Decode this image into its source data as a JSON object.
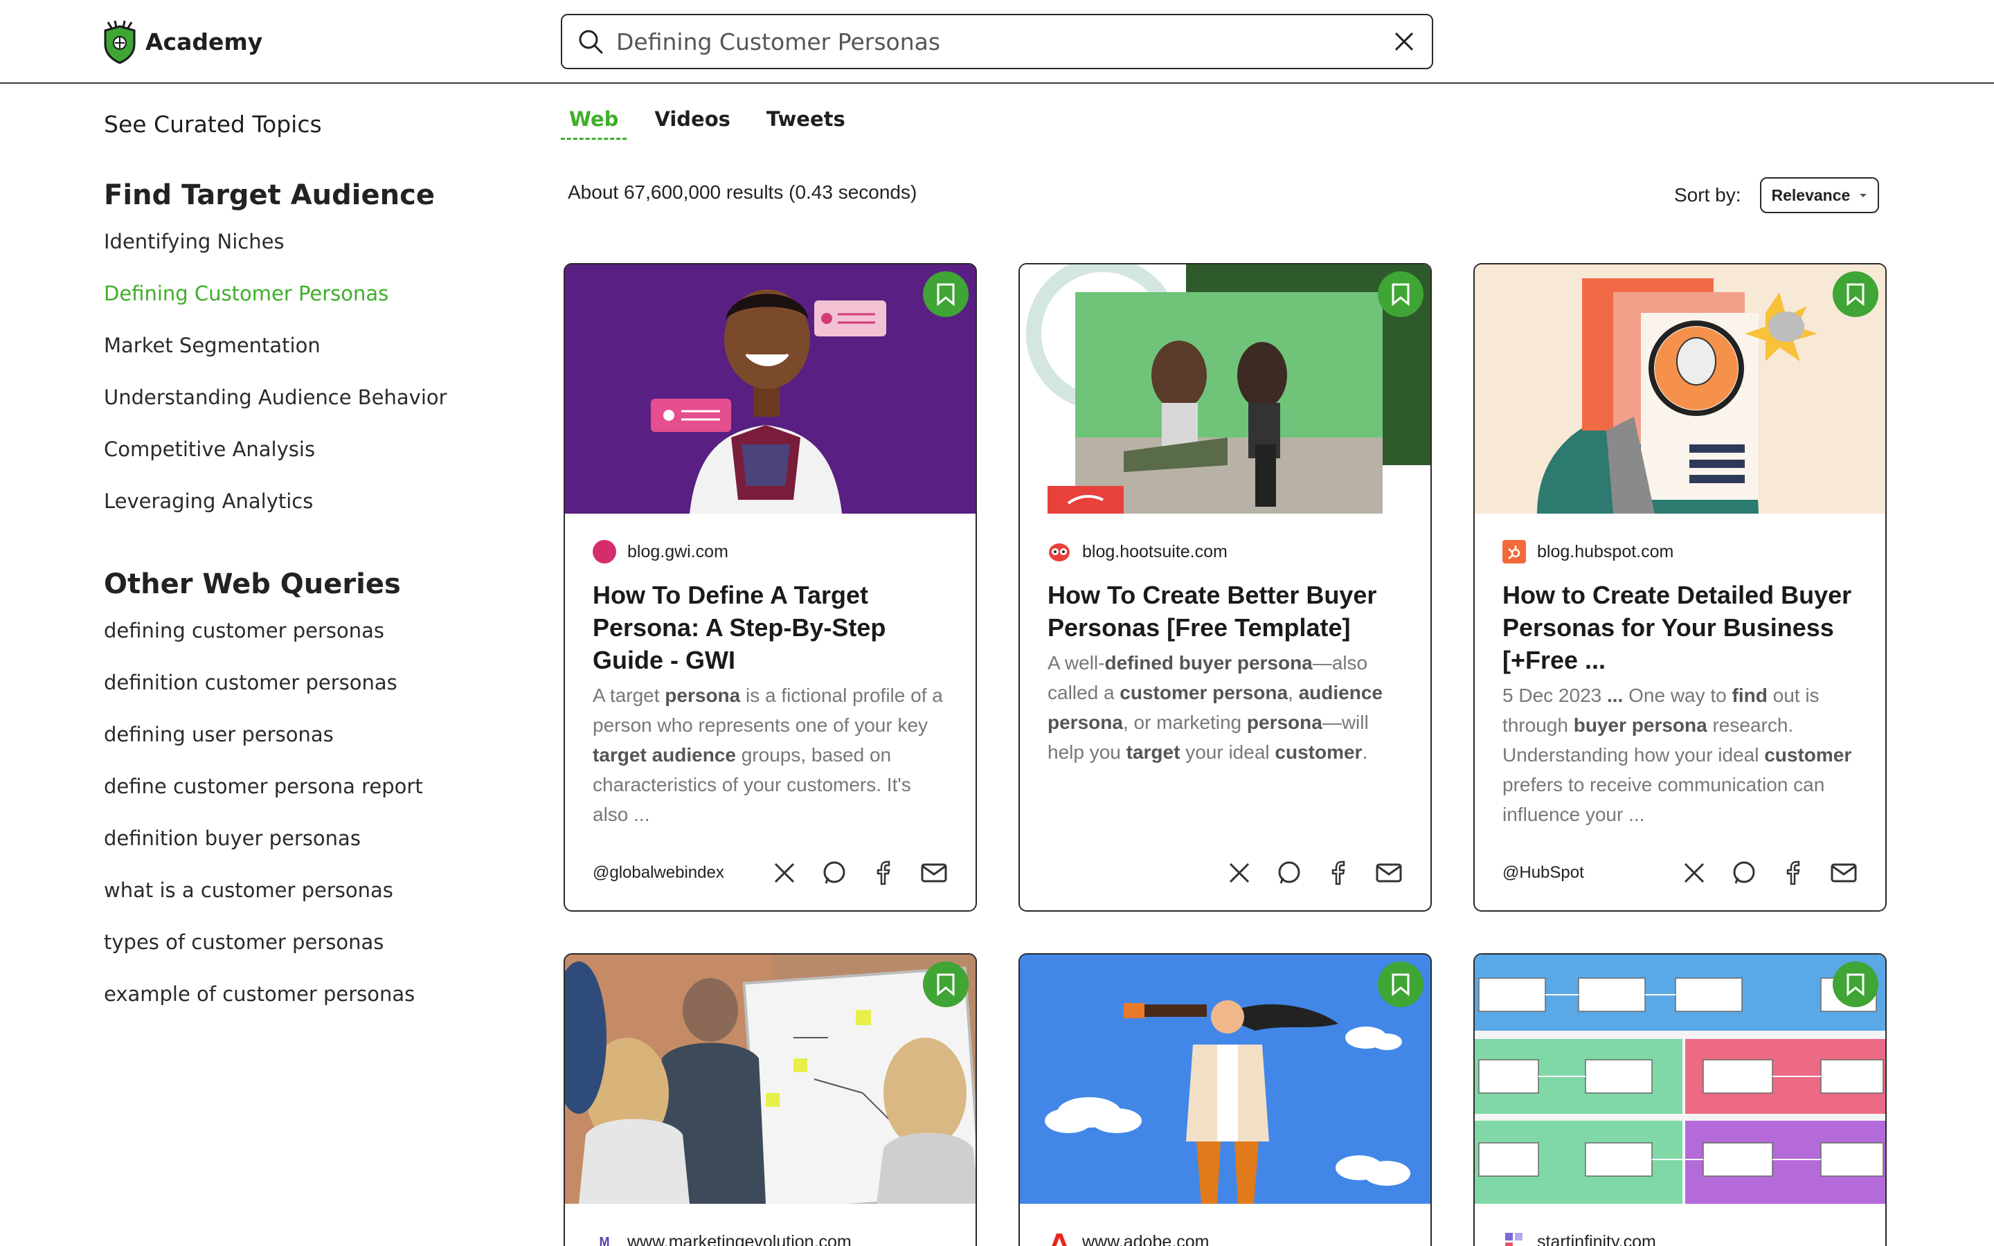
{
  "header": {
    "logo_text": "Academy",
    "search_value": "Defining Customer Personas"
  },
  "sidebar": {
    "curated_link": "See Curated Topics",
    "section1_title": "Find Target Audience",
    "section1_items": [
      "Identifying Niches",
      "Defining Customer Personas",
      "Market Segmentation",
      "Understanding Audience Behavior",
      "Competitive Analysis",
      "Leveraging Analytics"
    ],
    "section2_title": "Other Web Queries",
    "section2_items": [
      "defining customer personas",
      "definition customer personas",
      "defining user personas",
      "define customer persona report",
      "definition buyer personas",
      "what is a customer personas",
      "types of customer personas",
      "example of customer personas"
    ]
  },
  "tabs": [
    "Web",
    "Videos",
    "Tweets"
  ],
  "results_info": "About 67,600,000 results (0.43 seconds)",
  "sort": {
    "label": "Sort by:",
    "value": "Relevance"
  },
  "cards": [
    {
      "source": "blog.gwi.com",
      "title": "How To Define A Target Persona: A Step-By-Step Guide - GWI",
      "snippet_html": "A target <b>persona</b> is a fictional profile of a person who represents one of your key <b>target audience</b> groups, based on characteristics of your customers. It's also ...",
      "handle": "@globalwebindex"
    },
    {
      "source": "blog.hootsuite.com",
      "title": "How To Create Better Buyer Personas [Free Template]",
      "snippet_html": "A well-<b>defined buyer persona</b>—also called a <b>customer persona</b>, <b>audience persona</b>, or marketing <b>persona</b>—will help you <b>target</b> your ideal <b>customer</b>.",
      "handle": ""
    },
    {
      "source": "blog.hubspot.com",
      "title": "How to Create Detailed Buyer Personas for Your Business [+Free ...",
      "snippet_html": "5 Dec 2023 <b>...</b> One way to <b>find</b> out is through <b>buyer persona</b> research. Understanding how your ideal <b>customer</b> prefers to receive communication can influence your ...",
      "handle": "@HubSpot"
    },
    {
      "source": "www.marketingevolution.com"
    },
    {
      "source": "www.adobe.com"
    },
    {
      "source": "startinfinity.com"
    }
  ],
  "colors": {
    "accent": "#3fae2a",
    "bookmark": "#3fa534"
  }
}
